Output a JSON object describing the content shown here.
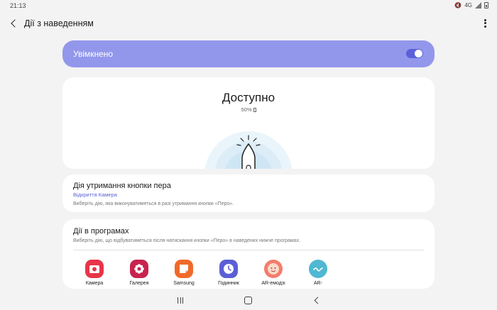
{
  "status_bar": {
    "time": "21:13",
    "network": "4G"
  },
  "app_bar": {
    "title": "Дії з наведенням"
  },
  "master_toggle": {
    "label": "Увімкнено",
    "on": true
  },
  "pen_status": {
    "title": "Доступно",
    "battery": "50%"
  },
  "hold_action": {
    "title": "Дія утримання кнопки пера",
    "value": "Відкриття Камера",
    "description": "Виберіть дію, яка виконуватиметься в разі утримання кнопки «Перо»."
  },
  "app_actions": {
    "title": "Дії в програмах",
    "description": "Виберіть дію, що відбуватиметься після натискання кнопки «Перо» в наведених нижче програмах.",
    "apps": [
      {
        "label": "Камера",
        "color": "#e8354a",
        "icon": "camera-icon"
      },
      {
        "label": "Галерея",
        "color": "#c8234f",
        "icon": "gallery-icon"
      },
      {
        "label": "Samsung",
        "color": "#f06a2a",
        "icon": "samsung-notes-icon"
      },
      {
        "label": "Годинник",
        "color": "#5b5fd6",
        "icon": "clock-icon"
      },
      {
        "label": "AR-емодзі",
        "color": "#f27d6d",
        "icon": "ar-emoji-icon"
      },
      {
        "label": "AR-",
        "color": "#4fb8d2",
        "icon": "ar-doodle-icon"
      }
    ]
  },
  "colors": {
    "accent": "#9397ec",
    "link": "#5b62d6"
  }
}
